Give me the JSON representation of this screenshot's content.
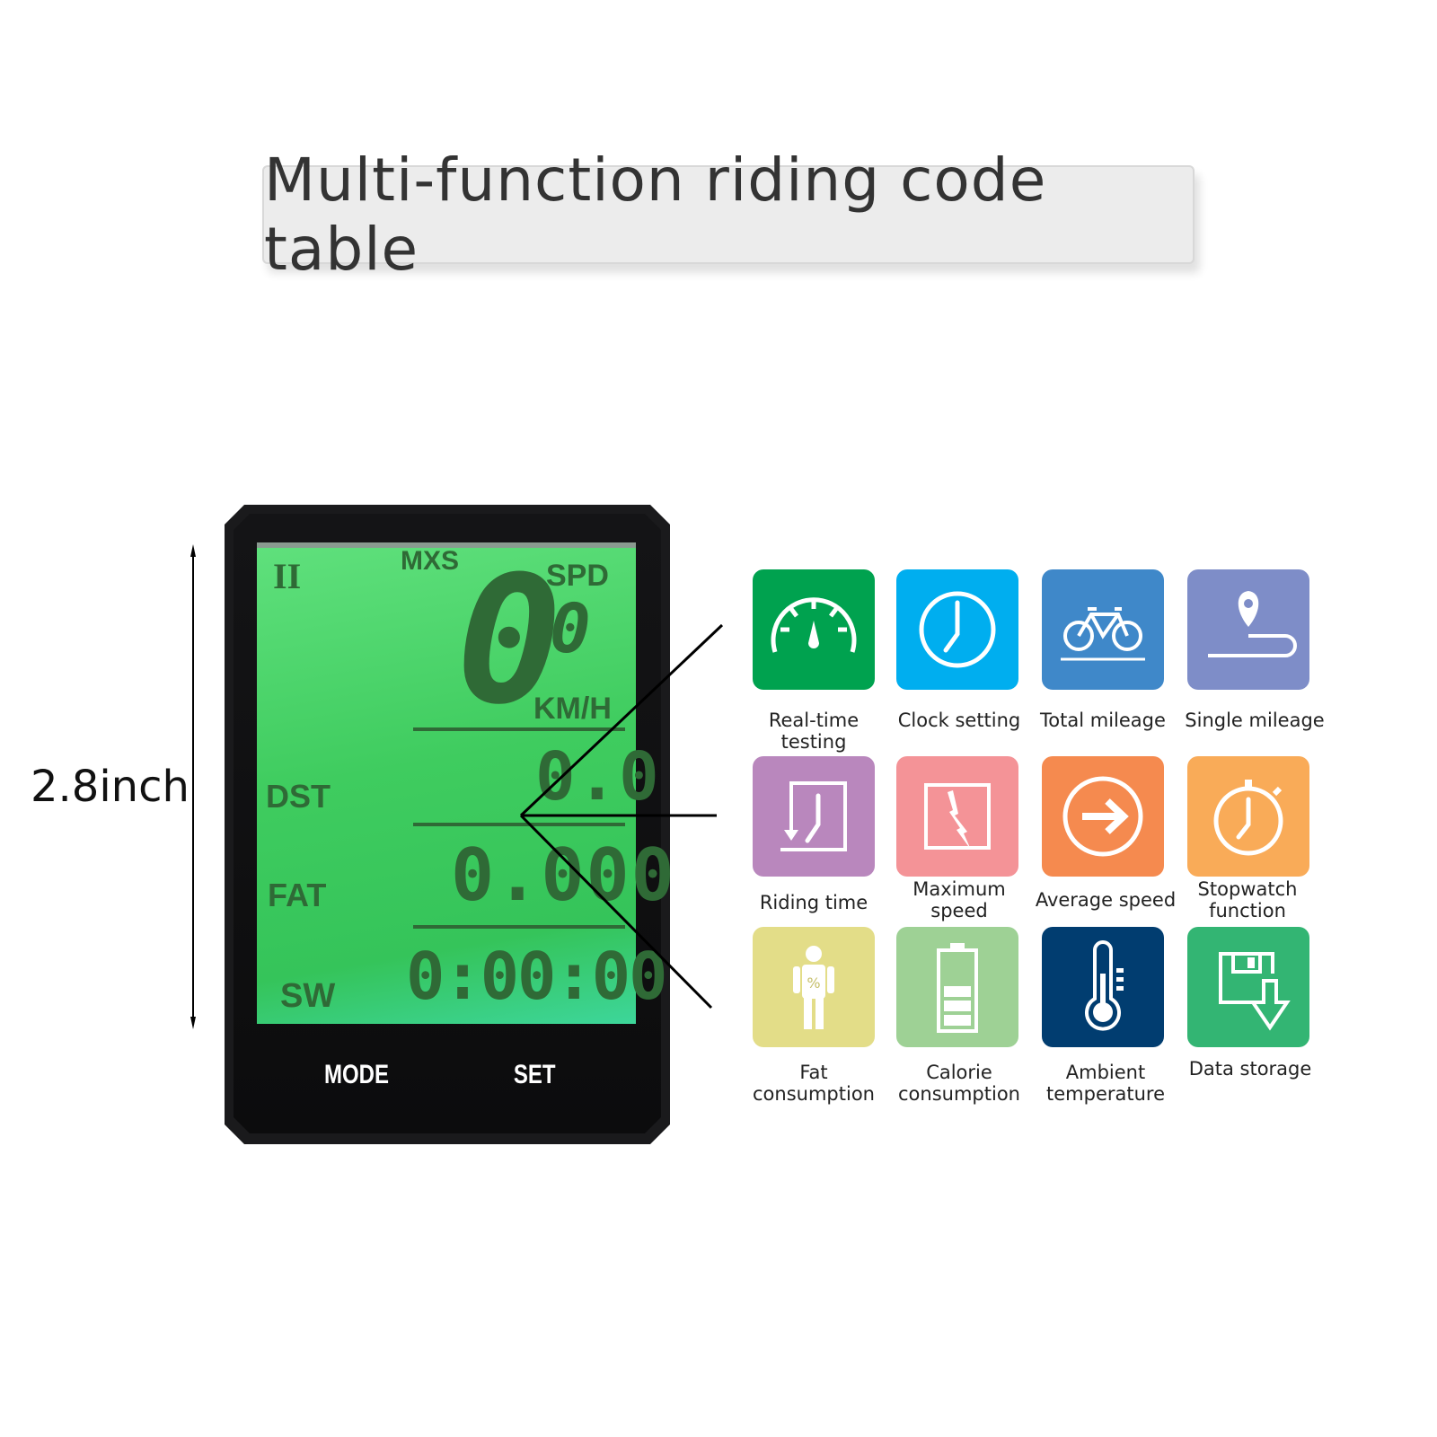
{
  "title": "Multi-function riding code table",
  "dimension": {
    "label": "2.8inch"
  },
  "device": {
    "indicator": "II",
    "mxs": "MXS",
    "spd_label": "SPD",
    "speed_main": "0",
    "speed_small": "0",
    "speed_unit": "KM/H",
    "dst_label": "DST",
    "dst_value": "0.0",
    "fat_label": "FAT",
    "fat_value": "0.000",
    "sw_label": "SW",
    "sw_value": "0:00:00",
    "buttons": {
      "mode": "MODE",
      "set": "SET"
    }
  },
  "features": [
    {
      "label": "Real-time testing",
      "icon": "speedometer-icon",
      "color": "#00a24f"
    },
    {
      "label": "Clock setting",
      "icon": "clock-icon",
      "color": "#00aeef"
    },
    {
      "label": "Total mileage",
      "icon": "bicycle-icon",
      "color": "#3f88c9"
    },
    {
      "label": "Single mileage",
      "icon": "map-pin-route-icon",
      "color": "#7e8dc8"
    },
    {
      "label": "Riding time",
      "icon": "riding-time-icon",
      "color": "#b987bd"
    },
    {
      "label": "Maximum speed",
      "icon": "lightning-icon",
      "color": "#f49397"
    },
    {
      "label": "Average speed",
      "icon": "arrow-circle-icon",
      "color": "#f58a4f"
    },
    {
      "label": "Stopwatch function",
      "icon": "stopwatch-icon",
      "color": "#f9ab58"
    },
    {
      "label": "Fat consumption",
      "icon": "body-fat-icon",
      "color": "#e3dd88"
    },
    {
      "label": "Calorie consumption",
      "icon": "battery-icon",
      "color": "#9ed195"
    },
    {
      "label": "Ambient temperature",
      "icon": "thermometer-icon",
      "color": "#013d70"
    },
    {
      "label": "Data storage",
      "icon": "save-download-icon",
      "color": "#33b573"
    }
  ]
}
